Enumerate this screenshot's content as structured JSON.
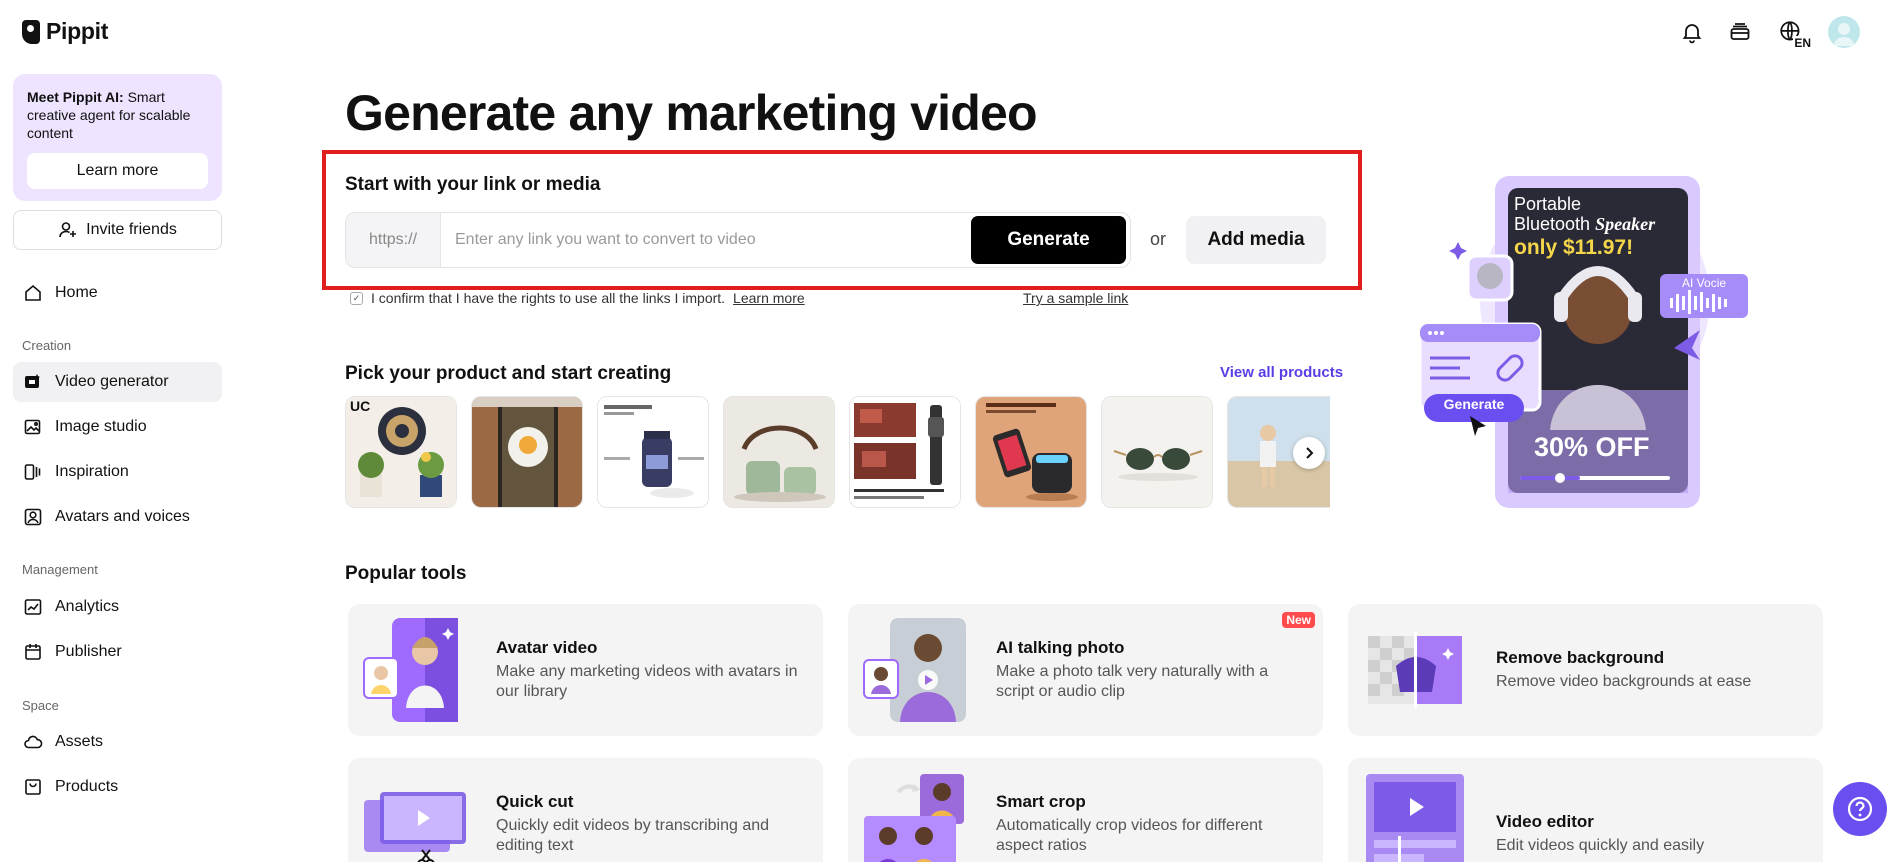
{
  "brand": {
    "name": "Pippit"
  },
  "sidebar": {
    "promo": {
      "title": "Meet Pippit AI:",
      "text": "Smart creative agent for scalable content",
      "button": "Learn more"
    },
    "invite": "Invite friends",
    "home": "Home",
    "sections": {
      "creation": "Creation",
      "management": "Management",
      "space": "Space"
    },
    "items": {
      "video_generator": "Video generator",
      "image_studio": "Image studio",
      "inspiration": "Inspiration",
      "avatars": "Avatars and voices",
      "analytics": "Analytics",
      "publisher": "Publisher",
      "assets": "Assets",
      "products": "Products"
    }
  },
  "topbar": {
    "lang": "EN"
  },
  "main": {
    "title": "Generate any marketing video",
    "start_label": "Start with your link or media",
    "prefix": "https://",
    "placeholder": "Enter any link you want to convert to video",
    "generate": "Generate",
    "or": "or",
    "add_media": "Add media",
    "confirm_text": "I confirm that I have the rights to use all the links I import.",
    "confirm_link": "Learn more",
    "sample_link": "Try a sample link",
    "pick_title": "Pick your product and start creating",
    "view_all": "View all products",
    "popular_title": "Popular tools"
  },
  "tools": [
    {
      "name": "Avatar video",
      "desc": "Make any marketing videos with avatars in our library"
    },
    {
      "name": "AI talking photo",
      "desc": "Make a photo talk very naturally with a script or audio clip",
      "badge": "New"
    },
    {
      "name": "Remove background",
      "desc": "Remove video backgrounds at ease"
    },
    {
      "name": "Quick cut",
      "desc": "Quickly edit videos by transcribing and editing text"
    },
    {
      "name": "Smart crop",
      "desc": "Automatically crop videos for different aspect ratios"
    },
    {
      "name": "Video editor",
      "desc": "Edit videos quickly and easily"
    }
  ],
  "hero": {
    "line1": "Portable",
    "line2": "Bluetooth",
    "line2b": "Speaker",
    "price": "only $11.97!",
    "off": "30% OFF",
    "ai_voice": "AI Vocie",
    "generate": "Generate"
  },
  "colors": {
    "accent": "#5a3de6",
    "highlight": "#e31d1d",
    "promo_bg": "#efe4ff"
  }
}
